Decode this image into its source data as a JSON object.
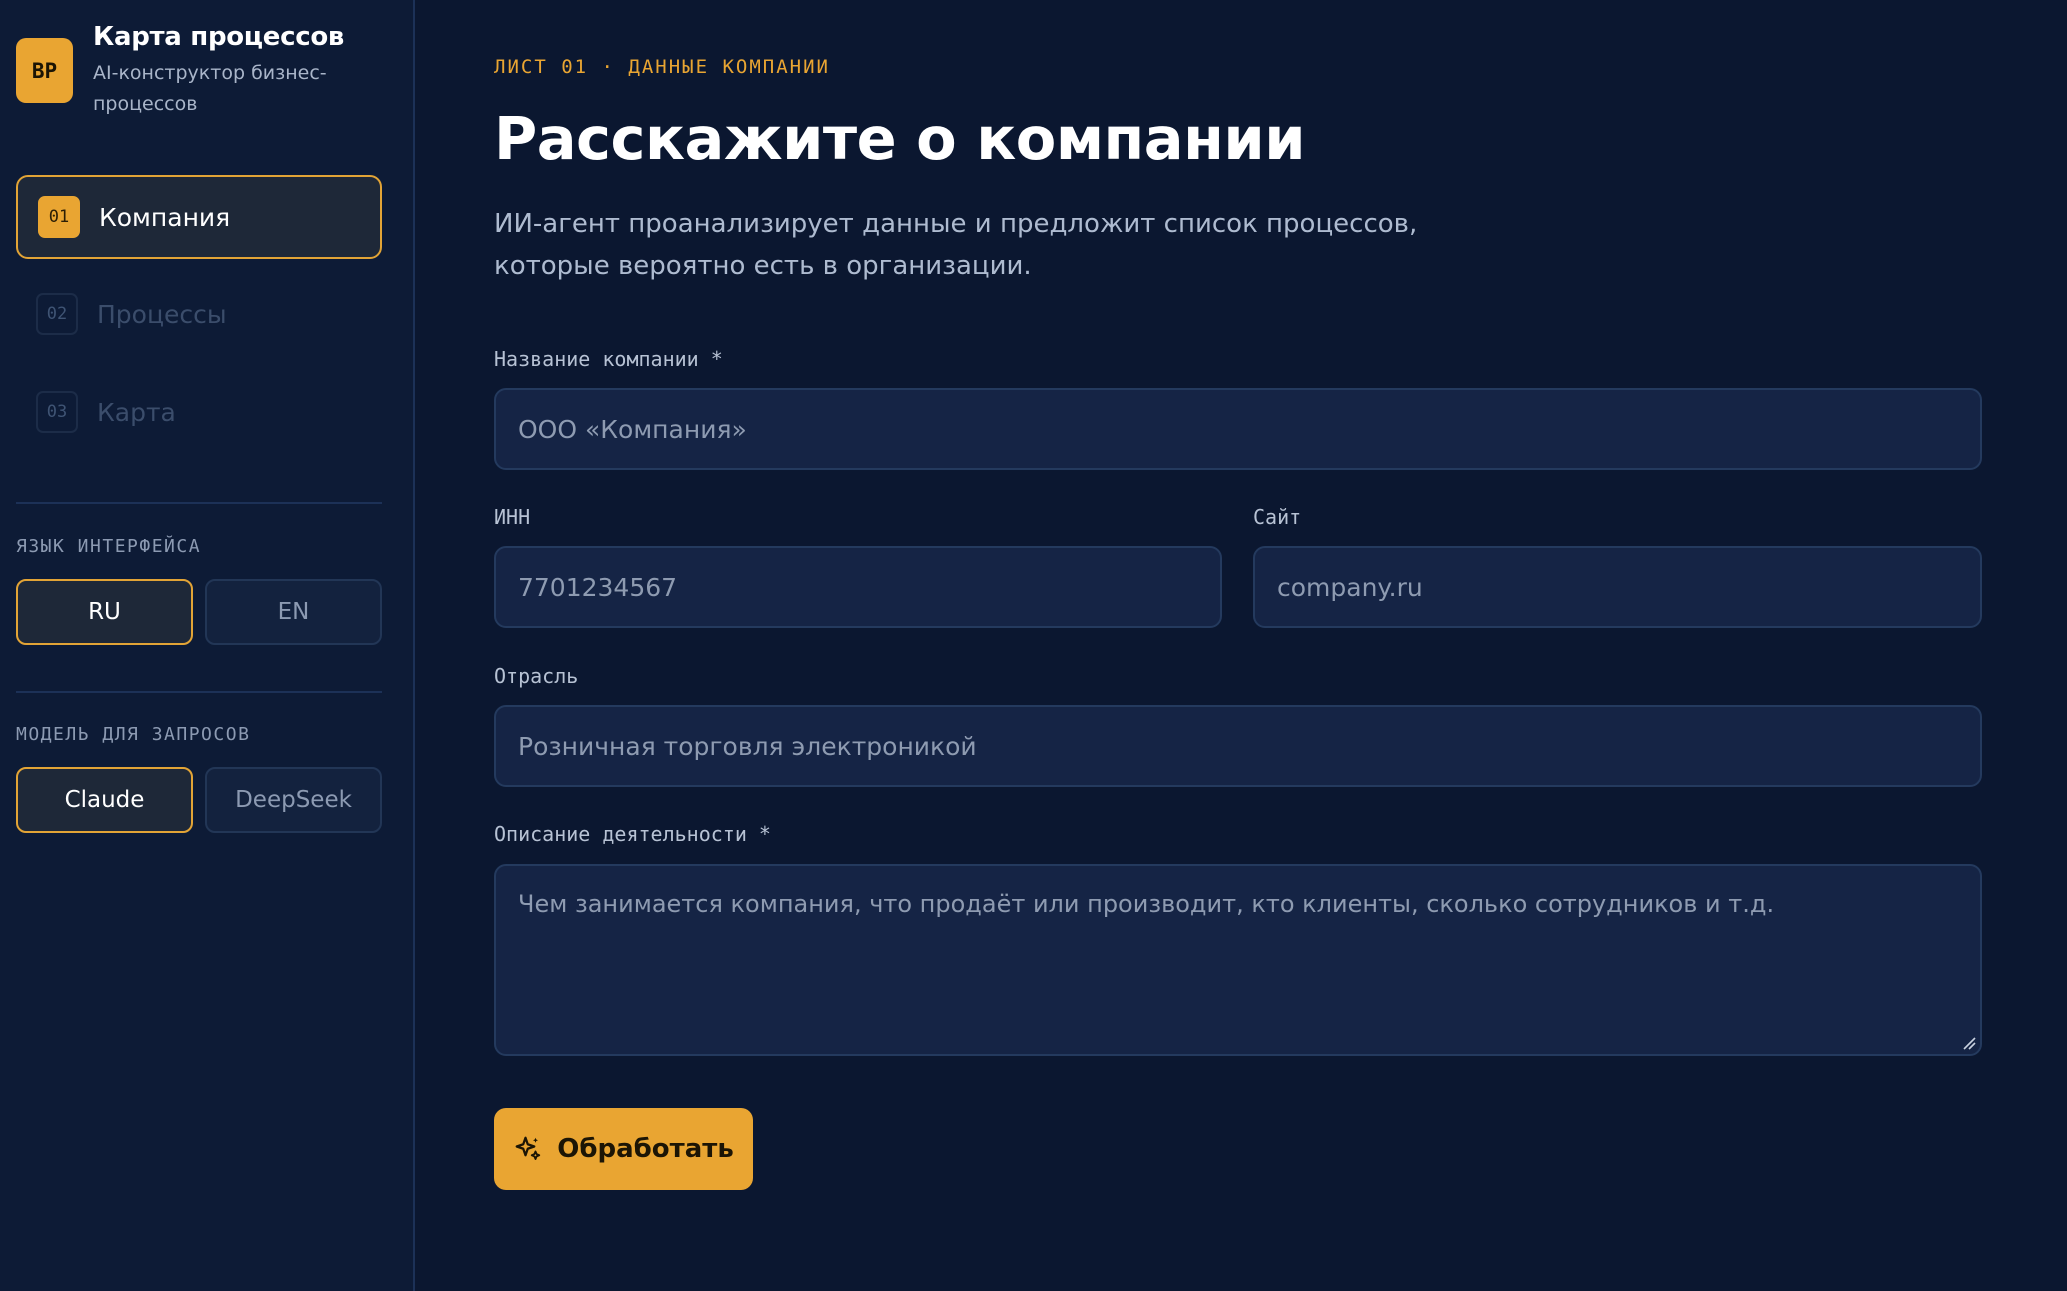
{
  "brand": {
    "logo": "BP",
    "title": "Карта процессов",
    "subtitle": "AI-конструктор бизнес-процессов"
  },
  "nav": {
    "items": [
      {
        "num": "01",
        "label": "Компания",
        "active": true
      },
      {
        "num": "02",
        "label": "Процессы",
        "active": false
      },
      {
        "num": "03",
        "label": "Карта",
        "active": false
      }
    ]
  },
  "language": {
    "label": "ЯЗЫК ИНТЕРФЕЙСА",
    "options": [
      "RU",
      "EN"
    ],
    "selected": "RU"
  },
  "model": {
    "label": "МОДЕЛЬ ДЛЯ ЗАПРОСОВ",
    "options": [
      "Claude",
      "DeepSeek"
    ],
    "selected": "Claude"
  },
  "main": {
    "kicker": "ЛИСТ 01 · ДАННЫЕ КОМПАНИИ",
    "title": "Расскажите о компании",
    "lead": "ИИ-агент проанализирует данные и предложит список процессов, которые вероятно есть в организации.",
    "fields": {
      "company_name": {
        "label": "Название компании *",
        "placeholder": "ООО «Компания»"
      },
      "inn": {
        "label": "ИНН",
        "placeholder": "7701234567"
      },
      "site": {
        "label": "Сайт",
        "placeholder": "company.ru"
      },
      "industry": {
        "label": "Отрасль",
        "placeholder": "Розничная торговля электроникой"
      },
      "description": {
        "label": "Описание деятельности *",
        "placeholder": "Чем занимается компания, что продаёт или производит, кто клиенты, сколько сотрудников и т.д."
      }
    },
    "submit_label": "Обработать",
    "submit_icon": "sparkle-icon"
  },
  "colors": {
    "accent": "#e9a532",
    "background": "#0b1730",
    "sidebar": "#0d1b36",
    "input_bg": "#152445"
  }
}
